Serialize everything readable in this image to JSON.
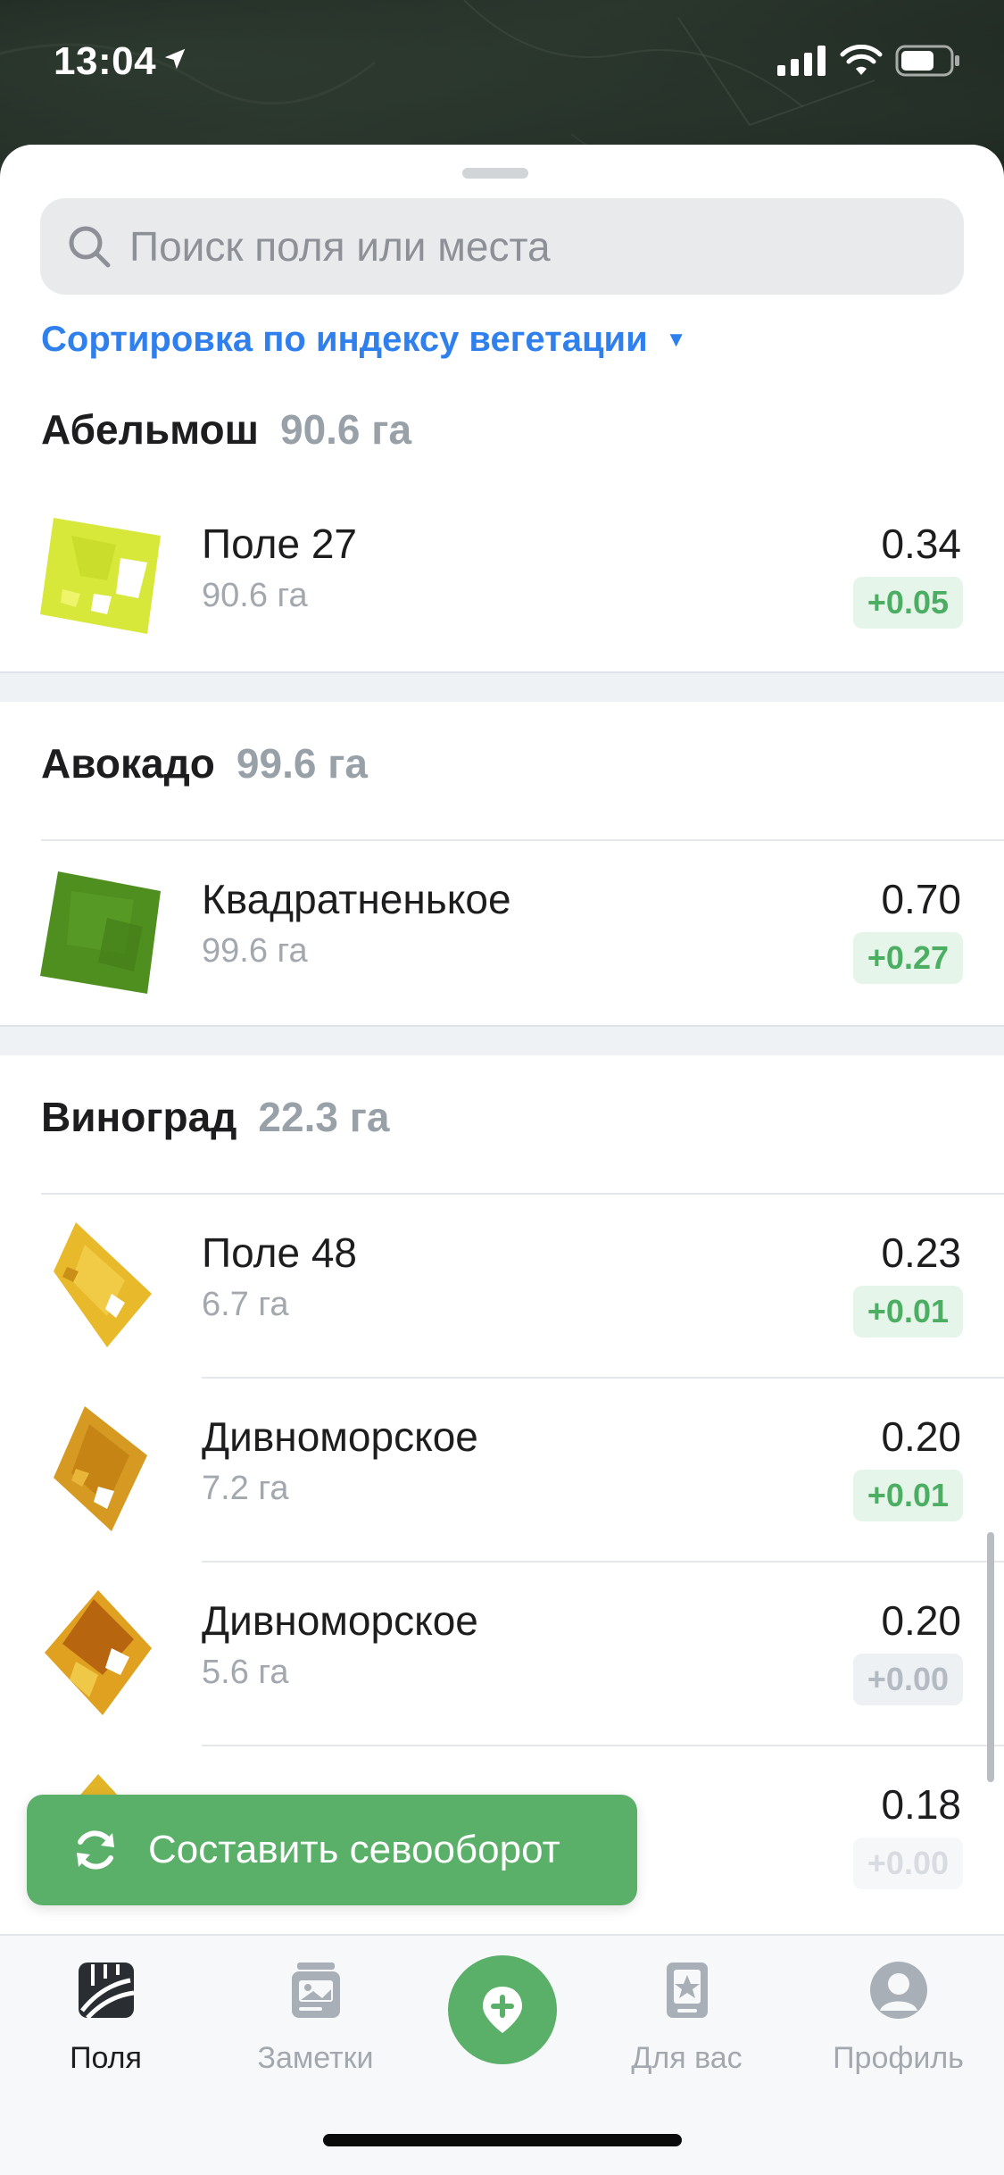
{
  "status_bar": {
    "time": "13:04"
  },
  "search": {
    "placeholder": "Поиск поля или места"
  },
  "sort": {
    "label": "Сортировка по индексу вегетации"
  },
  "groups": [
    {
      "name": "Абельмош",
      "area": "90.6 га",
      "fields": [
        {
          "name": "Поле 27",
          "size": "90.6 га",
          "ndvi": "0.34",
          "delta": "+0.05",
          "trend": "pos",
          "color": "#d8e83a"
        }
      ]
    },
    {
      "name": "Авокадо",
      "area": "99.6 га",
      "fields": [
        {
          "name": "Квадратненькое",
          "size": "99.6 га",
          "ndvi": "0.70",
          "delta": "+0.27",
          "trend": "pos",
          "color": "#4f8f1f"
        }
      ]
    },
    {
      "name": "Виноград",
      "area": "22.3 га",
      "fields": [
        {
          "name": "Поле 48",
          "size": "6.7 га",
          "ndvi": "0.23",
          "delta": "+0.01",
          "trend": "pos",
          "color": "#e8b92a"
        },
        {
          "name": "Дивноморское",
          "size": "7.2 га",
          "ndvi": "0.20",
          "delta": "+0.01",
          "trend": "pos",
          "color": "#d69a22"
        },
        {
          "name": "Дивноморское",
          "size": "5.6 га",
          "ndvi": "0.20",
          "delta": "+0.00",
          "trend": "zero",
          "color": "#c46a12"
        },
        {
          "name": "",
          "size": "",
          "ndvi": "0.18",
          "delta": "+0.00",
          "trend": "zero",
          "color": "#e2b428"
        }
      ]
    }
  ],
  "cta": {
    "label": "Составить севооборот"
  },
  "tabbar": {
    "fields": "Поля",
    "notes": "Заметки",
    "for_you": "Для вас",
    "profile": "Профиль"
  },
  "colors": {
    "accent_blue": "#2f80ed",
    "accent_green": "#5aaf69",
    "positive_text": "#4cae62"
  }
}
